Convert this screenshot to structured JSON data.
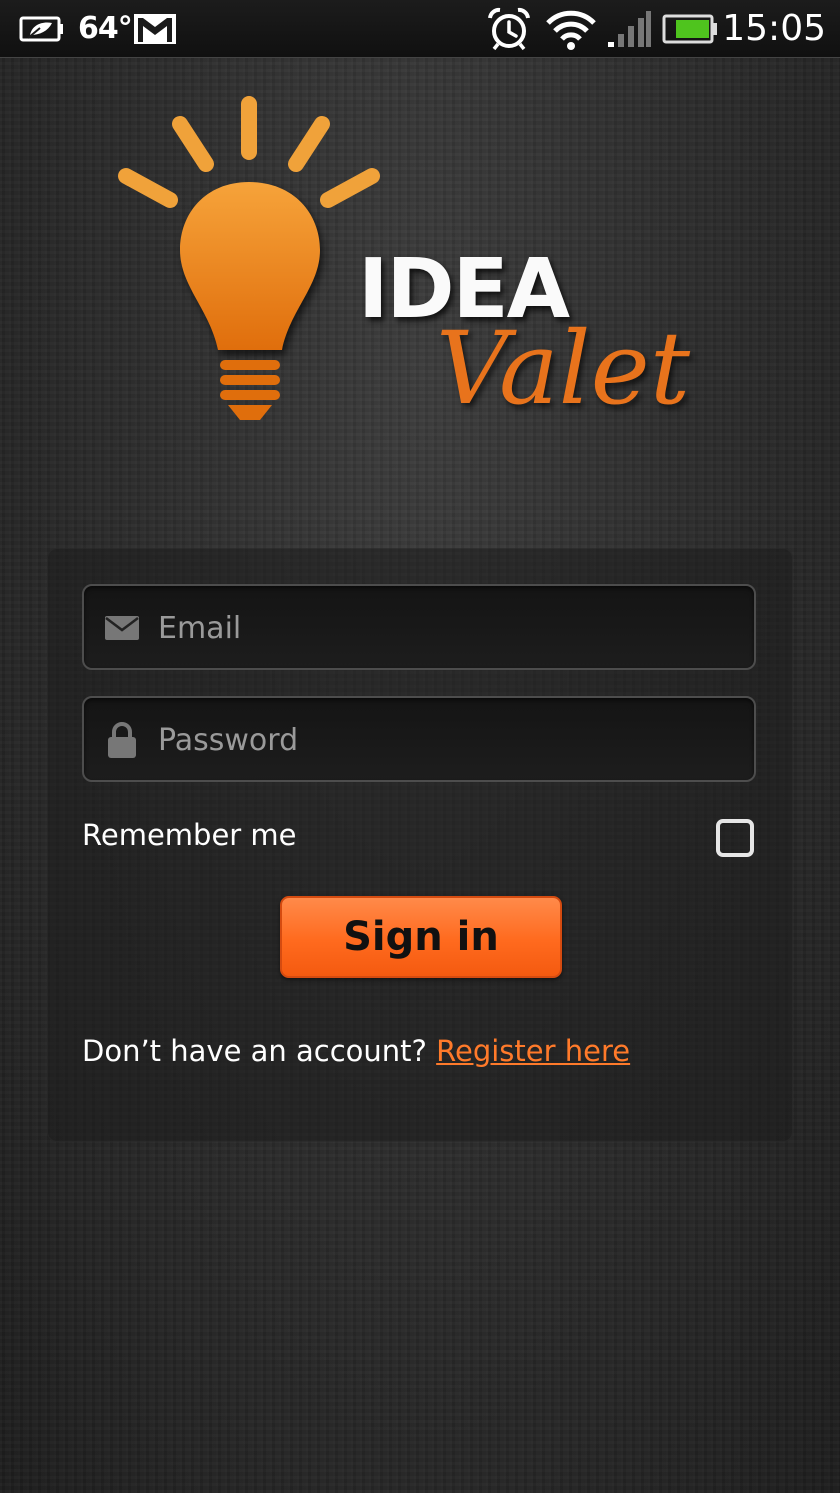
{
  "status_bar": {
    "temperature": "64°",
    "time": "15:05",
    "icons": [
      "leaf-battery-icon",
      "gmail-icon",
      "alarm-icon",
      "wifi-icon",
      "signal-icon",
      "battery-icon"
    ]
  },
  "logo": {
    "line1": "IDEA",
    "line2": "Valet"
  },
  "login": {
    "email_placeholder": "Email",
    "password_placeholder": "Password",
    "remember_label": "Remember me",
    "remember_checked": false,
    "signin_label": "Sign in",
    "register_prompt": "Don’t have an account?",
    "register_link": "Register here"
  },
  "colors": {
    "accent": "#ff6a1e",
    "logo_orange": "#e8731c",
    "battery_green": "#4fc41e"
  }
}
